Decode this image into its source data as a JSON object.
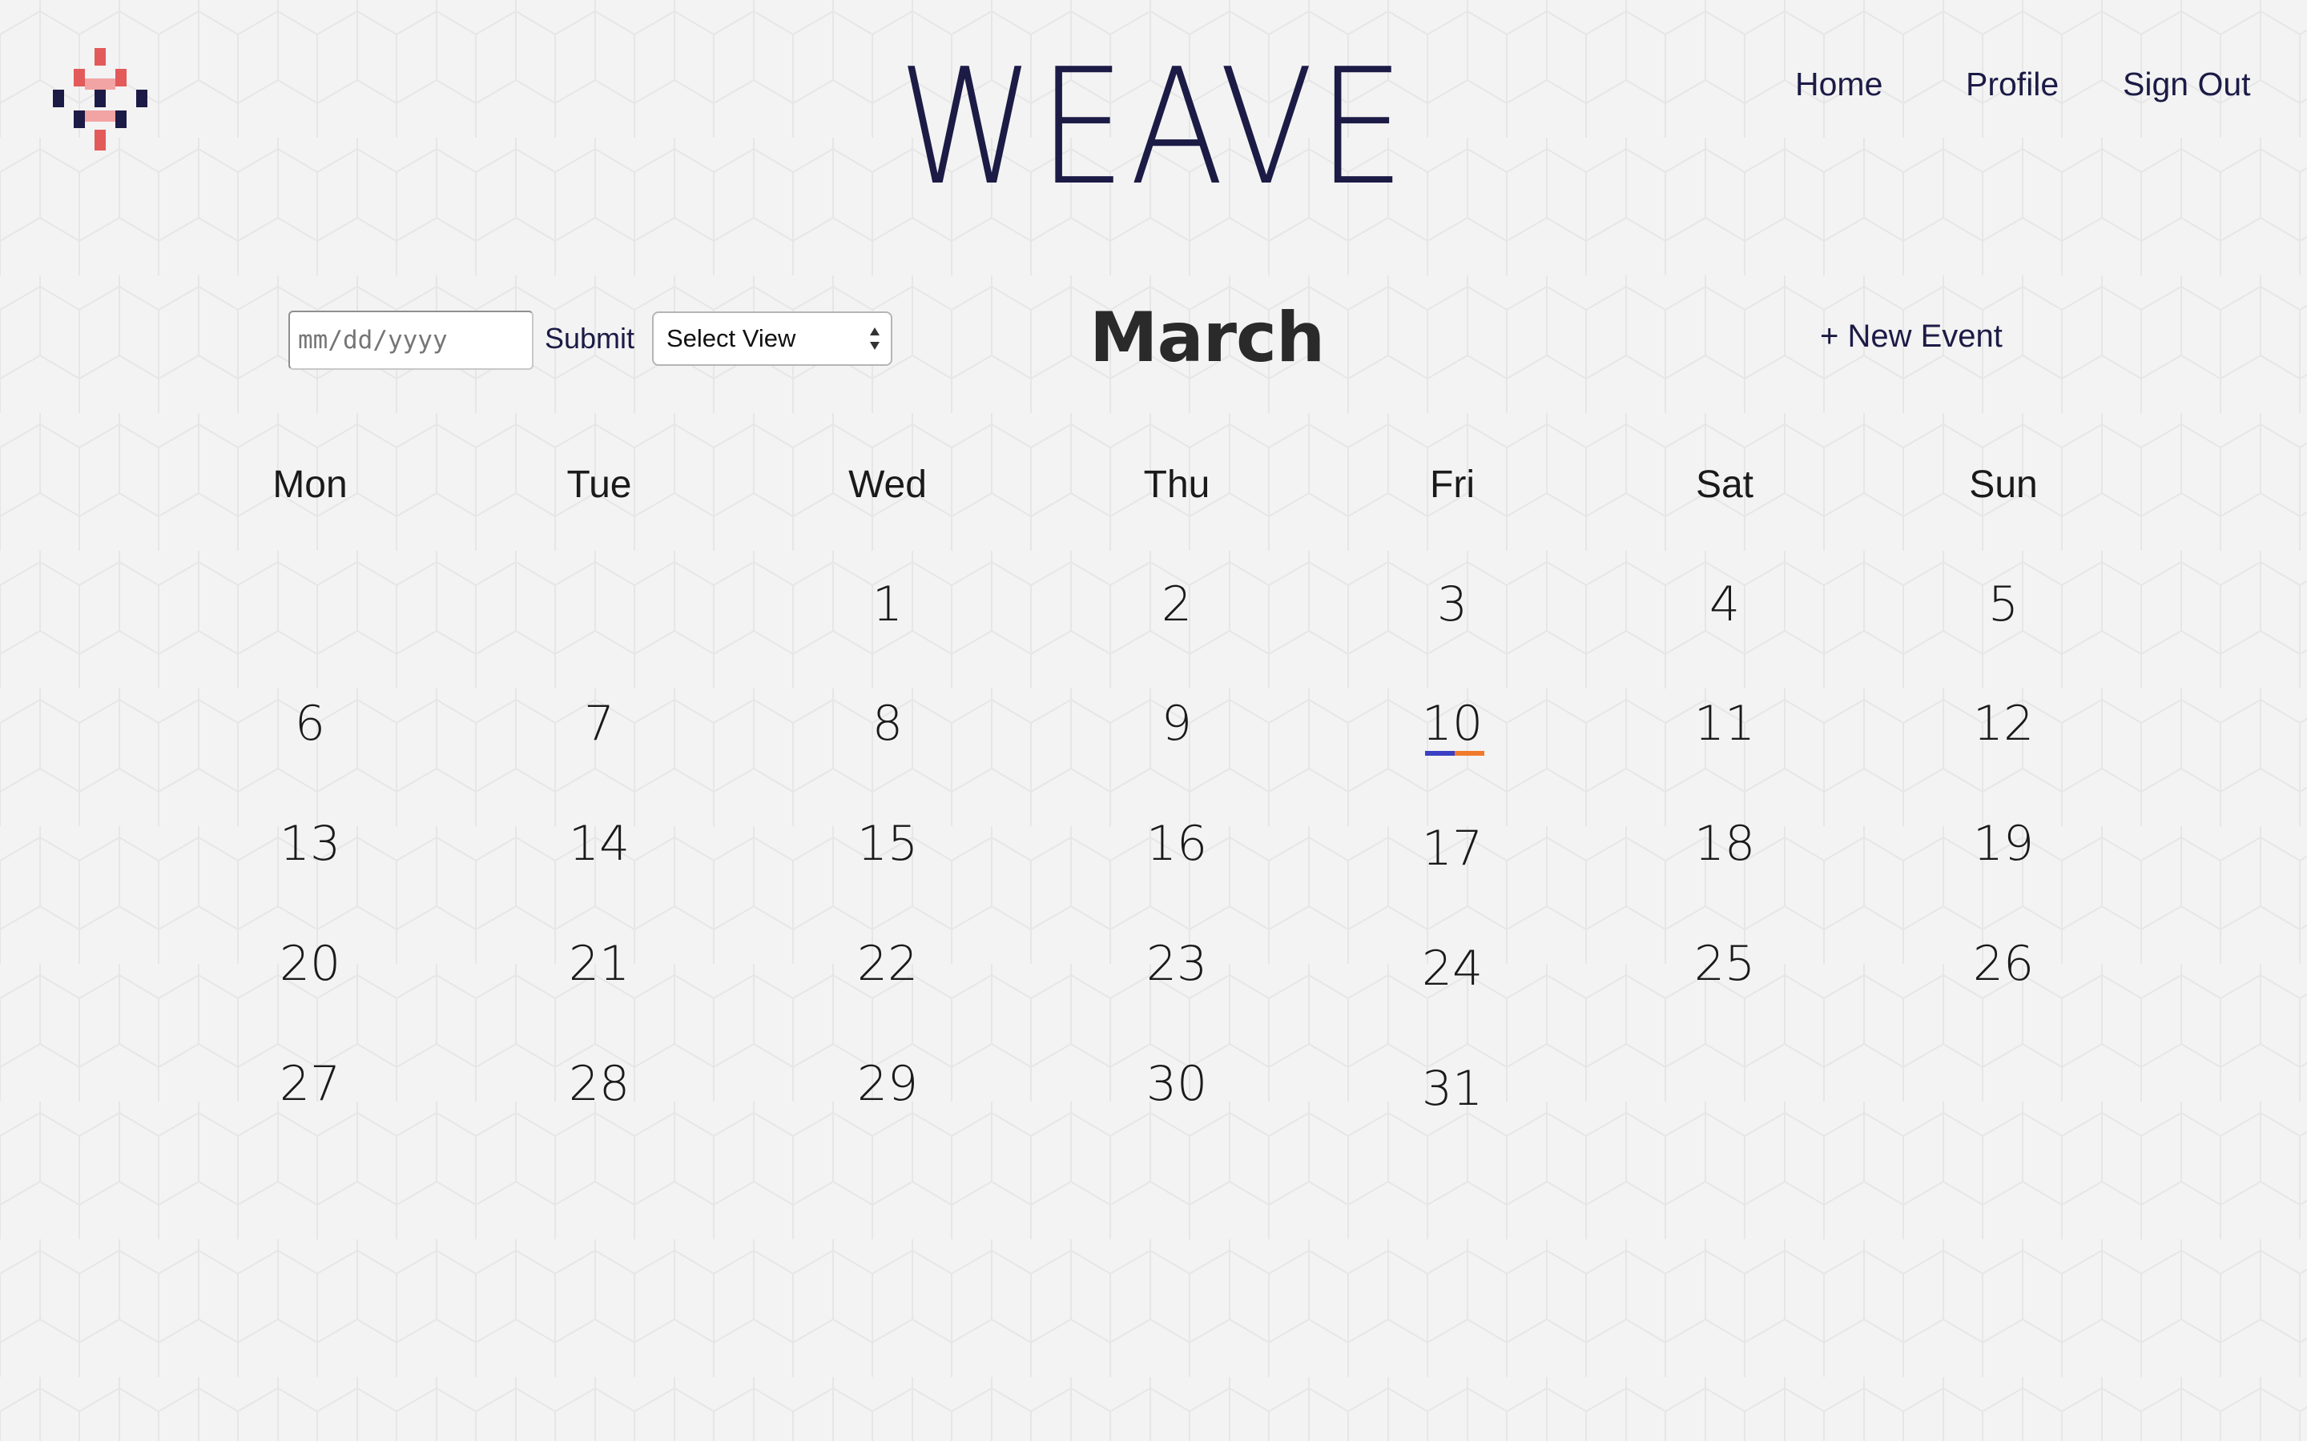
{
  "header": {
    "app_title": "WEAVE",
    "nav": {
      "home": "Home",
      "profile": "Profile",
      "sign_out": "Sign Out"
    }
  },
  "toolbar": {
    "date_placeholder": "mm/dd/yyyy",
    "submit_label": "Submit",
    "select_view": "Select View",
    "new_event_label": "+ New Event"
  },
  "calendar": {
    "month": "March",
    "weekdays": [
      "Mon",
      "Tue",
      "Wed",
      "Thu",
      "Fri",
      "Sat",
      "Sun"
    ],
    "weeks": [
      [
        "",
        "",
        "1",
        "2",
        "3",
        "4",
        "5"
      ],
      [
        "6",
        "7",
        "8",
        "9",
        "10",
        "11",
        "12"
      ],
      [
        "13",
        "14",
        "15",
        "16",
        "17",
        "18",
        "19"
      ],
      [
        "20",
        "21",
        "22",
        "23",
        "24",
        "25",
        "26"
      ],
      [
        "27",
        "28",
        "29",
        "30",
        "31",
        "",
        ""
      ]
    ],
    "event_day": "10",
    "event_colors": [
      "#3b3fc4",
      "#f07a2a"
    ]
  },
  "colors": {
    "brand_navy": "#1c1b46",
    "logo_red": "#e35a5a",
    "logo_pink": "#f2a3a3",
    "background": "#f3f3f3"
  },
  "icons": {
    "logo": "weave-logo-icon",
    "select_arrows": "updown-arrows-icon"
  }
}
